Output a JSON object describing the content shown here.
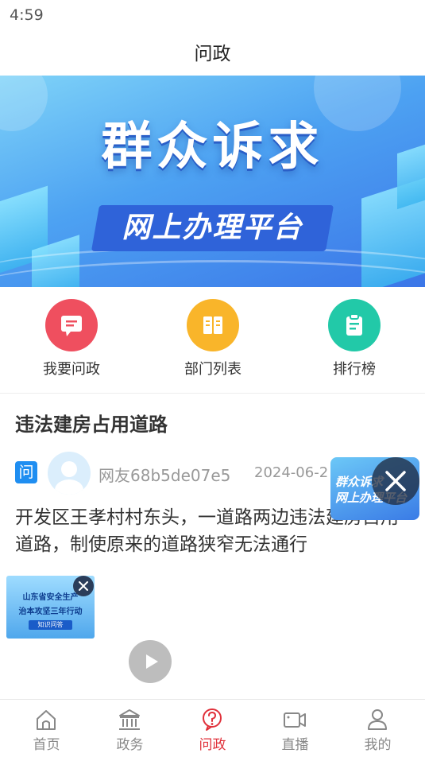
{
  "status_bar": {
    "time": "4:59"
  },
  "header": {
    "title": "问政"
  },
  "banner": {
    "title": "群众诉求",
    "subtitle": "网上办理平台"
  },
  "quick_menu": [
    {
      "label": "我要问政",
      "icon": "chat-icon",
      "color": "#ef4f5f"
    },
    {
      "label": "部门列表",
      "icon": "book-icon",
      "color": "#f9b52a"
    },
    {
      "label": "排行榜",
      "icon": "clipboard-icon",
      "color": "#22c9a8"
    }
  ],
  "post": {
    "title": "违法建房占用道路",
    "badge": "问",
    "author": "网友68b5de07e5",
    "date": "2024-06-2",
    "content": "开发区王孝村村东头，一道路两边违法建房占用道路，制使原来的道路狭窄无法通行"
  },
  "floating_ad": {
    "line1": "群众诉求",
    "line2": "网上办理平台"
  },
  "side_ad": {
    "line1": "山东省安全生产",
    "line2": "治本攻坚三年行动",
    "tag": "知识问答"
  },
  "tabs": [
    {
      "label": "首页",
      "icon": "home-icon",
      "active": false
    },
    {
      "label": "政务",
      "icon": "government-icon",
      "active": false
    },
    {
      "label": "问政",
      "icon": "question-icon",
      "active": true
    },
    {
      "label": "直播",
      "icon": "video-icon",
      "active": false
    },
    {
      "label": "我的",
      "icon": "user-icon",
      "active": false
    }
  ],
  "colors": {
    "accent": "#e0303a",
    "badge_blue": "#1f8ef1",
    "inactive": "#888888"
  }
}
